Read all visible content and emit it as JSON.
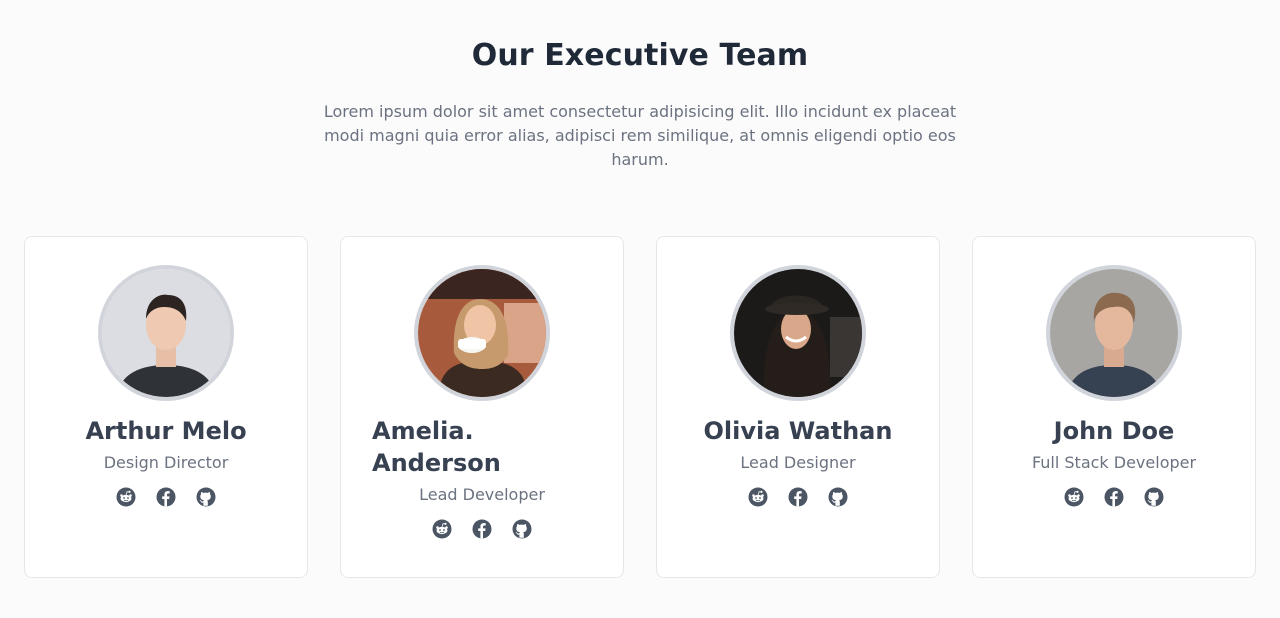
{
  "header": {
    "title": "Our Executive Team",
    "subtitle": "Lorem ipsum dolor sit amet consectetur adipisicing elit. Illo incidunt ex placeat modi magni quia error alias, adipisci rem similique, at omnis eligendi optio eos harum."
  },
  "team": [
    {
      "name": "Arthur Melo",
      "role": "Design Director",
      "socials": [
        "reddit-icon",
        "facebook-icon",
        "github-icon"
      ]
    },
    {
      "name": "Amelia. Anderson",
      "role": "Lead Developer",
      "socials": [
        "reddit-icon",
        "facebook-icon",
        "github-icon"
      ]
    },
    {
      "name": "Olivia Wathan",
      "role": "Lead Designer",
      "socials": [
        "reddit-icon",
        "facebook-icon",
        "github-icon"
      ]
    },
    {
      "name": "John Doe",
      "role": "Full Stack Developer",
      "socials": [
        "reddit-icon",
        "facebook-icon",
        "github-icon"
      ]
    }
  ],
  "colors": {
    "background": "#fbfbfc",
    "heading": "#1f2937",
    "name": "#374151",
    "muted": "#6b7280",
    "icon": "#4b5563",
    "card_border": "#e5e7eb",
    "avatar_ring": "#d1d5db"
  }
}
